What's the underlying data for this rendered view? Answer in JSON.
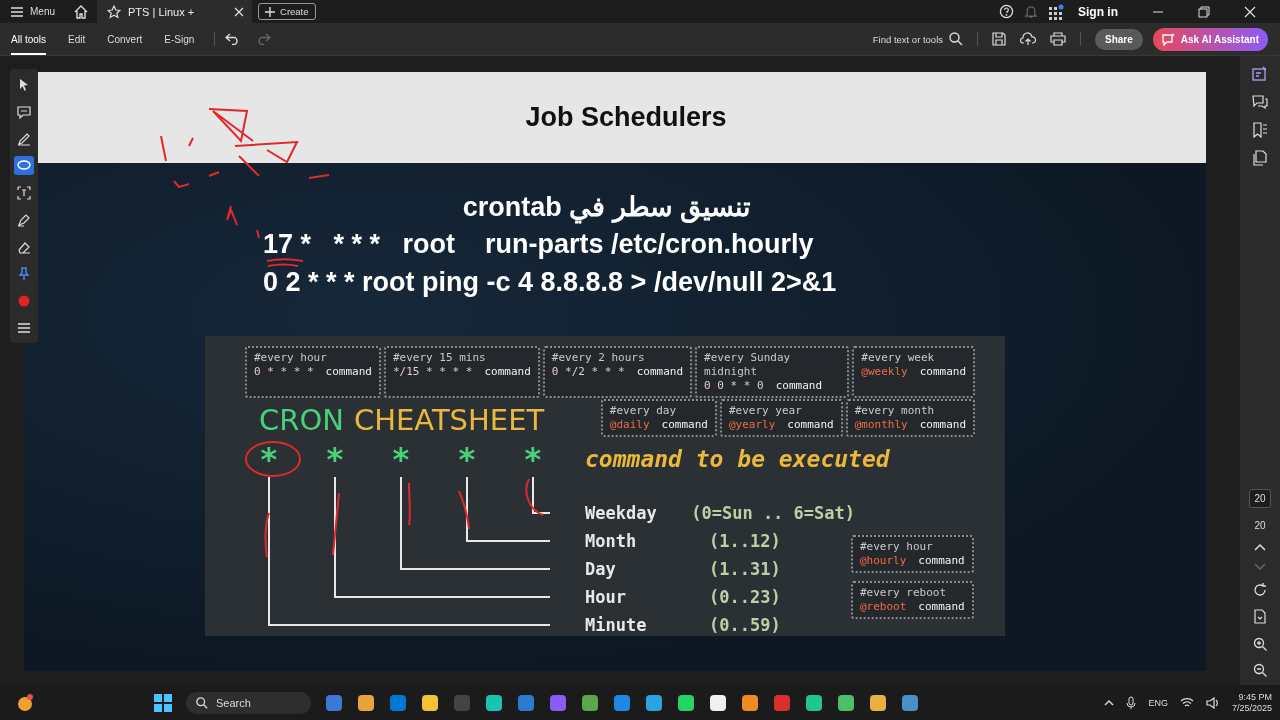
{
  "app_bar": {
    "menu": "Menu",
    "tab": {
      "title": "PTS | Linux +",
      "selected": true
    },
    "create": "Create",
    "sign_in": "Sign in"
  },
  "toolbar": {
    "items": [
      {
        "label": "All tools",
        "selected": true
      },
      {
        "label": "Edit",
        "selected": false
      },
      {
        "label": "Convert",
        "selected": false
      },
      {
        "label": "E-Sign",
        "selected": false
      }
    ],
    "find": "Find text or tools",
    "share": "Share",
    "ai": "Ask AI Assistant"
  },
  "tool_rail": [
    {
      "selected": false
    },
    {
      "selected": false
    },
    {
      "selected": false
    },
    {
      "selected": true
    },
    {
      "selected": false
    },
    {
      "selected": false
    },
    {
      "selected": false
    },
    {
      "selected": false
    },
    {
      "selected": false
    },
    {
      "selected": false
    }
  ],
  "slide": {
    "title": "Job Schedulers",
    "lines": [
      "تنسيق سطر في crontab",
      "17 *   * * *   root    run-parts /etc/cron.hourly",
      "0 2 * * * root ping -c 4 8.8.8.8 > /dev/null 2>&1"
    ],
    "cheatsheet": {
      "title_1": "CRON",
      "title_2": "CHEATSHEET",
      "top_boxes": [
        {
          "comment": "#every hour",
          "schedule": "0 * * * *",
          "command": "command",
          "kind": "fields"
        },
        {
          "comment": "#every 15 mins",
          "schedule": "*/15 * * * *",
          "command": "command",
          "kind": "fields"
        },
        {
          "comment": "#every 2 hours",
          "schedule": "0 */2 * * *",
          "command": "command",
          "kind": "fields"
        },
        {
          "comment": "#every Sunday midnight",
          "schedule": "0 0 * * 0",
          "command": "command",
          "kind": "fields"
        },
        {
          "comment": "#every week",
          "schedule": "@weekly",
          "command": "command",
          "kind": "macro"
        }
      ],
      "mid_boxes": [
        {
          "comment": "#every day",
          "schedule": "@daily",
          "command": "command",
          "kind": "macro"
        },
        {
          "comment": "#every year",
          "schedule": "@yearly",
          "command": "command",
          "kind": "macro"
        },
        {
          "comment": "#every month",
          "schedule": "@monthly",
          "command": "command",
          "kind": "macro"
        }
      ],
      "stars": [
        "*",
        "*",
        "*",
        "*",
        "*"
      ],
      "command_label": "command to be executed",
      "fields": [
        {
          "name": "Weekday",
          "range": "(0=Sun .. 6=Sat)"
        },
        {
          "name": "Month",
          "range": "(1..12)"
        },
        {
          "name": "Day",
          "range": "(1..31)"
        },
        {
          "name": "Hour",
          "range": "(0..23)"
        },
        {
          "name": "Minute",
          "range": "(0..59)"
        }
      ],
      "side_boxes": [
        {
          "comment": "#every hour",
          "schedule": "@hourly",
          "command": "command",
          "kind": "macro"
        },
        {
          "comment": "#every reboot",
          "schedule": "@reboot",
          "command": "command",
          "kind": "macro"
        }
      ]
    }
  },
  "page_nav": {
    "current": "20",
    "total": "20"
  },
  "taskbar": {
    "search": "Search",
    "language": "ENG",
    "time": "9:45 PM",
    "date": "7/25/2025"
  }
}
